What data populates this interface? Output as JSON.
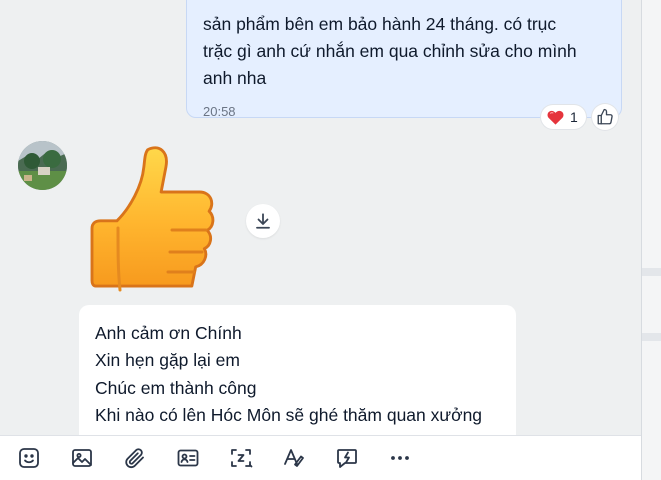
{
  "outgoing_message": {
    "text": "sản phẩm bên em bảo hành 24 tháng. có trục\ntrặc gì anh cứ nhắn em qua chỉnh sửa cho mình\nanh nha",
    "time": "20:58",
    "reaction": {
      "icon": "heart-icon",
      "count": "1"
    }
  },
  "sticker": {
    "icon": "thumbs-up-sticker"
  },
  "incoming_message": {
    "lines": [
      "Anh cảm ơn Chính",
      "Xin hẹn gặp lại em",
      "Chúc em thành công",
      "Khi nào có lên Hóc Môn sẽ ghé thăm quan xưởng"
    ]
  },
  "toolbar": {
    "items": [
      "sticker-icon",
      "image-icon",
      "attachment-icon",
      "contact-card-icon",
      "screenshot-icon",
      "text-format-icon",
      "quick-message-icon",
      "more-icon"
    ]
  },
  "colors": {
    "chat_bg": "#eef0f1",
    "outgoing_bubble": "#e5efff",
    "incoming_bubble": "#ffffff",
    "accent": "#0068ff"
  }
}
